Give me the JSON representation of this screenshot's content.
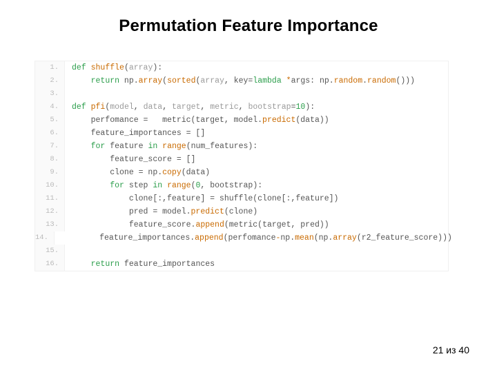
{
  "title": "Permutation Feature Importance",
  "pager": {
    "current": "21",
    "sep": "из",
    "total": "40"
  },
  "code": {
    "lines": [
      {
        "n": "1.",
        "tokens": [
          {
            "c": "kw",
            "t": "def"
          },
          {
            "c": "plain",
            "t": " "
          },
          {
            "c": "fn",
            "t": "shuffle"
          },
          {
            "c": "plain",
            "t": "("
          },
          {
            "c": "arg",
            "t": "array"
          },
          {
            "c": "plain",
            "t": "):"
          }
        ]
      },
      {
        "n": "2.",
        "tokens": [
          {
            "c": "plain",
            "t": "    "
          },
          {
            "c": "kw",
            "t": "return"
          },
          {
            "c": "plain",
            "t": " np."
          },
          {
            "c": "fn",
            "t": "array"
          },
          {
            "c": "plain",
            "t": "("
          },
          {
            "c": "fn",
            "t": "sorted"
          },
          {
            "c": "plain",
            "t": "("
          },
          {
            "c": "arg",
            "t": "array"
          },
          {
            "c": "plain",
            "t": ", key="
          },
          {
            "c": "kw",
            "t": "lambda"
          },
          {
            "c": "plain",
            "t": " "
          },
          {
            "c": "op",
            "t": "*"
          },
          {
            "c": "plain",
            "t": "args: np."
          },
          {
            "c": "fn",
            "t": "random"
          },
          {
            "c": "plain",
            "t": "."
          },
          {
            "c": "fn",
            "t": "random"
          },
          {
            "c": "plain",
            "t": "()))"
          }
        ]
      },
      {
        "n": "3.",
        "tokens": [
          {
            "c": "plain",
            "t": ""
          }
        ]
      },
      {
        "n": "4.",
        "tokens": [
          {
            "c": "kw",
            "t": "def"
          },
          {
            "c": "plain",
            "t": " "
          },
          {
            "c": "fn",
            "t": "pfi"
          },
          {
            "c": "plain",
            "t": "("
          },
          {
            "c": "arg",
            "t": "model"
          },
          {
            "c": "plain",
            "t": ", "
          },
          {
            "c": "arg",
            "t": "data"
          },
          {
            "c": "plain",
            "t": ", "
          },
          {
            "c": "arg",
            "t": "target"
          },
          {
            "c": "plain",
            "t": ", "
          },
          {
            "c": "arg",
            "t": "metric"
          },
          {
            "c": "plain",
            "t": ", "
          },
          {
            "c": "arg",
            "t": "bootstrap"
          },
          {
            "c": "plain",
            "t": "="
          },
          {
            "c": "num",
            "t": "10"
          },
          {
            "c": "plain",
            "t": "):"
          }
        ]
      },
      {
        "n": "5.",
        "tokens": [
          {
            "c": "plain",
            "t": "    perfomance =   metric(target, model."
          },
          {
            "c": "fn",
            "t": "predict"
          },
          {
            "c": "plain",
            "t": "(data))"
          }
        ]
      },
      {
        "n": "6.",
        "tokens": [
          {
            "c": "plain",
            "t": "    feature_importances = []"
          }
        ]
      },
      {
        "n": "7.",
        "tokens": [
          {
            "c": "plain",
            "t": "    "
          },
          {
            "c": "kw",
            "t": "for"
          },
          {
            "c": "plain",
            "t": " feature "
          },
          {
            "c": "kw",
            "t": "in"
          },
          {
            "c": "plain",
            "t": " "
          },
          {
            "c": "fn",
            "t": "range"
          },
          {
            "c": "plain",
            "t": "(num_features):"
          }
        ]
      },
      {
        "n": "8.",
        "tokens": [
          {
            "c": "plain",
            "t": "        feature_score = []"
          }
        ]
      },
      {
        "n": "9.",
        "tokens": [
          {
            "c": "plain",
            "t": "        clone = np."
          },
          {
            "c": "fn",
            "t": "copy"
          },
          {
            "c": "plain",
            "t": "(data)"
          }
        ]
      },
      {
        "n": "10.",
        "tokens": [
          {
            "c": "plain",
            "t": "        "
          },
          {
            "c": "kw",
            "t": "for"
          },
          {
            "c": "plain",
            "t": " step "
          },
          {
            "c": "kw",
            "t": "in"
          },
          {
            "c": "plain",
            "t": " "
          },
          {
            "c": "fn",
            "t": "range"
          },
          {
            "c": "plain",
            "t": "("
          },
          {
            "c": "num",
            "t": "0"
          },
          {
            "c": "plain",
            "t": ", bootstrap):"
          }
        ]
      },
      {
        "n": "11.",
        "tokens": [
          {
            "c": "plain",
            "t": "            clone[:,feature] = shuffle(clone[:,feature])"
          }
        ]
      },
      {
        "n": "12.",
        "tokens": [
          {
            "c": "plain",
            "t": "            pred = model."
          },
          {
            "c": "fn",
            "t": "predict"
          },
          {
            "c": "plain",
            "t": "(clone)"
          }
        ]
      },
      {
        "n": "13.",
        "tokens": [
          {
            "c": "plain",
            "t": "            feature_score."
          },
          {
            "c": "fn",
            "t": "append"
          },
          {
            "c": "plain",
            "t": "(metric(target, pred))"
          }
        ]
      },
      {
        "n": "14.",
        "tokens": [
          {
            "c": "plain",
            "t": "        feature_importances."
          },
          {
            "c": "fn",
            "t": "append"
          },
          {
            "c": "plain",
            "t": "(perfomance"
          },
          {
            "c": "op",
            "t": "-"
          },
          {
            "c": "plain",
            "t": "np."
          },
          {
            "c": "fn",
            "t": "mean"
          },
          {
            "c": "plain",
            "t": "(np."
          },
          {
            "c": "fn",
            "t": "array"
          },
          {
            "c": "plain",
            "t": "(r2_feature_score)))"
          }
        ]
      },
      {
        "n": "15.",
        "tokens": [
          {
            "c": "plain",
            "t": ""
          }
        ]
      },
      {
        "n": "16.",
        "tokens": [
          {
            "c": "plain",
            "t": "    "
          },
          {
            "c": "kw",
            "t": "return"
          },
          {
            "c": "plain",
            "t": " feature_importances"
          }
        ]
      }
    ]
  }
}
